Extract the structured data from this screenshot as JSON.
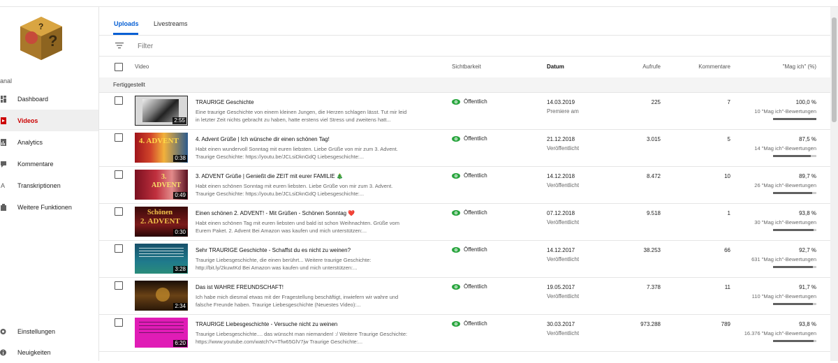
{
  "sidebar": {
    "channel_label": "anal",
    "items": [
      {
        "label": "Dashboard",
        "icon": "dashboard-icon"
      },
      {
        "label": "Videos",
        "icon": "videos-icon"
      },
      {
        "label": "Analytics",
        "icon": "analytics-icon"
      },
      {
        "label": "Kommentare",
        "icon": "comments-icon"
      },
      {
        "label": "Transkriptionen",
        "icon": "translate-icon"
      },
      {
        "label": "Weitere Funktionen",
        "icon": "more-features-icon"
      }
    ],
    "bottom_items": [
      {
        "label": "Einstellungen",
        "icon": "gear-icon"
      },
      {
        "label": "Neuigkeiten",
        "icon": "info-icon"
      }
    ]
  },
  "tabs": [
    {
      "label": "Uploads",
      "active": true
    },
    {
      "label": "Livestreams",
      "active": false
    }
  ],
  "filter": {
    "placeholder": "Filter"
  },
  "table": {
    "headers": {
      "video": "Video",
      "visibility": "Sichtbarkeit",
      "date": "Datum",
      "views": "Aufrufe",
      "comments": "Kommentare",
      "likes": "\"Mag ich\" (%)"
    },
    "section_label": "Fertiggestellt",
    "rows": [
      {
        "title": "TRAURIGE Geschichte",
        "description": "Eine traurige Geschichte von einem kleinen Jungen, die Herzen schlagen lässt. Tut mir leid in letzter Zeit nichts gebracht zu haben, hatte erstens viel Stress und zweitens hatt...",
        "duration": "2:55",
        "visibility": "Öffentlich",
        "date": "14.03.2019",
        "date_status": "Premiere am",
        "views": "225",
        "comments": "7",
        "likes_pct": "100,0 %",
        "ratings": "10 \"Mag ich\"-Bewertungen",
        "like_fraction": 1.0
      },
      {
        "title": "4. Advent Grüße | Ich wünsche dir einen schönen Tag!",
        "description": "Habt einen wundervoll Sonntag mit euren liebsten. Liebe Grüße von mir zum 3. Advent. Traurige Geschichte: https://youtu.be/JCLsiDknGdQ Liebesgeschichte:...",
        "duration": "0:38",
        "visibility": "Öffentlich",
        "date": "21.12.2018",
        "date_status": "Veröffentlicht",
        "views": "3.015",
        "comments": "5",
        "likes_pct": "87,5 %",
        "ratings": "14 \"Mag ich\"-Bewertungen",
        "like_fraction": 0.875
      },
      {
        "title": "3. ADVENT Grüße | Genießt die ZEIT mit eurer FAMILIE 🎄",
        "description": "Habt einen schönen Sonntag mit euren liebsten. Liebe Grüße von mir zum 3. Advent. Traurige Geschichte: https://youtu.be/JCLsiDknGdQ Liebesgeschichte:...",
        "duration": "0:49",
        "visibility": "Öffentlich",
        "date": "14.12.2018",
        "date_status": "Veröffentlicht",
        "views": "8.472",
        "comments": "10",
        "likes_pct": "89,7 %",
        "ratings": "26 \"Mag ich\"-Bewertungen",
        "like_fraction": 0.897
      },
      {
        "title": "Einen schönen 2. ADVENT! - Mit Grüßen - Schönen Sonntag ❤️",
        "description": "Habt einen schönen Tag mit euren liebsten und bald ist schon Weihnachten. Grüße vom Eurem Paket. 2. Advent Bei Amazon was kaufen und mich unterstützen:...",
        "duration": "0:30",
        "visibility": "Öffentlich",
        "date": "07.12.2018",
        "date_status": "Veröffentlicht",
        "views": "9.518",
        "comments": "1",
        "likes_pct": "93,8 %",
        "ratings": "30 \"Mag ich\"-Bewertungen",
        "like_fraction": 0.938
      },
      {
        "title": "Sehr TRAURIGE Geschichte - Schaffst du es nicht zu weinen?",
        "description": "Traurige Liebesgeschichte, die einen berührt... Weitere traurige Geschichte: http://bit.ly/2kuwIKd Bei Amazon was kaufen und mich unterstützen:...",
        "duration": "3:28",
        "visibility": "Öffentlich",
        "date": "14.12.2017",
        "date_status": "Veröffentlicht",
        "views": "38.253",
        "comments": "66",
        "likes_pct": "92,7 %",
        "ratings": "631 \"Mag ich\"-Bewertungen",
        "like_fraction": 0.927
      },
      {
        "title": "Das ist WAHRE FREUNDSCHAFT!",
        "description": "Ich habe mich diesmal etwas mit der Fragestellung beschäftigt, inwiefern wir wahre und falsche Freunde haben. Traurige Liebesgeschichte (Neuestes Video):...",
        "duration": "2:34",
        "visibility": "Öffentlich",
        "date": "19.05.2017",
        "date_status": "Veröffentlicht",
        "views": "7.378",
        "comments": "11",
        "likes_pct": "91,7 %",
        "ratings": "110 \"Mag ich\"-Bewertungen",
        "like_fraction": 0.917
      },
      {
        "title": "TRAURIGE Liebesgeschichte - Versuche nicht zu weinen",
        "description": "Traurige Liebesgeschichte.... das wünscht man niemanden! :/ Weitere Traurige Geschichte: https://www.youtube.com/watch?v=Tfw65GlV7jw Traurige Geschichte:...",
        "duration": "6:20",
        "visibility": "Öffentlich",
        "date": "30.03.2017",
        "date_status": "Veröffentlicht",
        "views": "973.288",
        "comments": "789",
        "likes_pct": "93,8 %",
        "ratings": "16.376 \"Mag ich\"-Bewertungen",
        "like_fraction": 0.938
      }
    ]
  },
  "colors": {
    "accent_blue": "#065fd4",
    "active_red": "#cc0000",
    "public_green": "#2ba640"
  }
}
